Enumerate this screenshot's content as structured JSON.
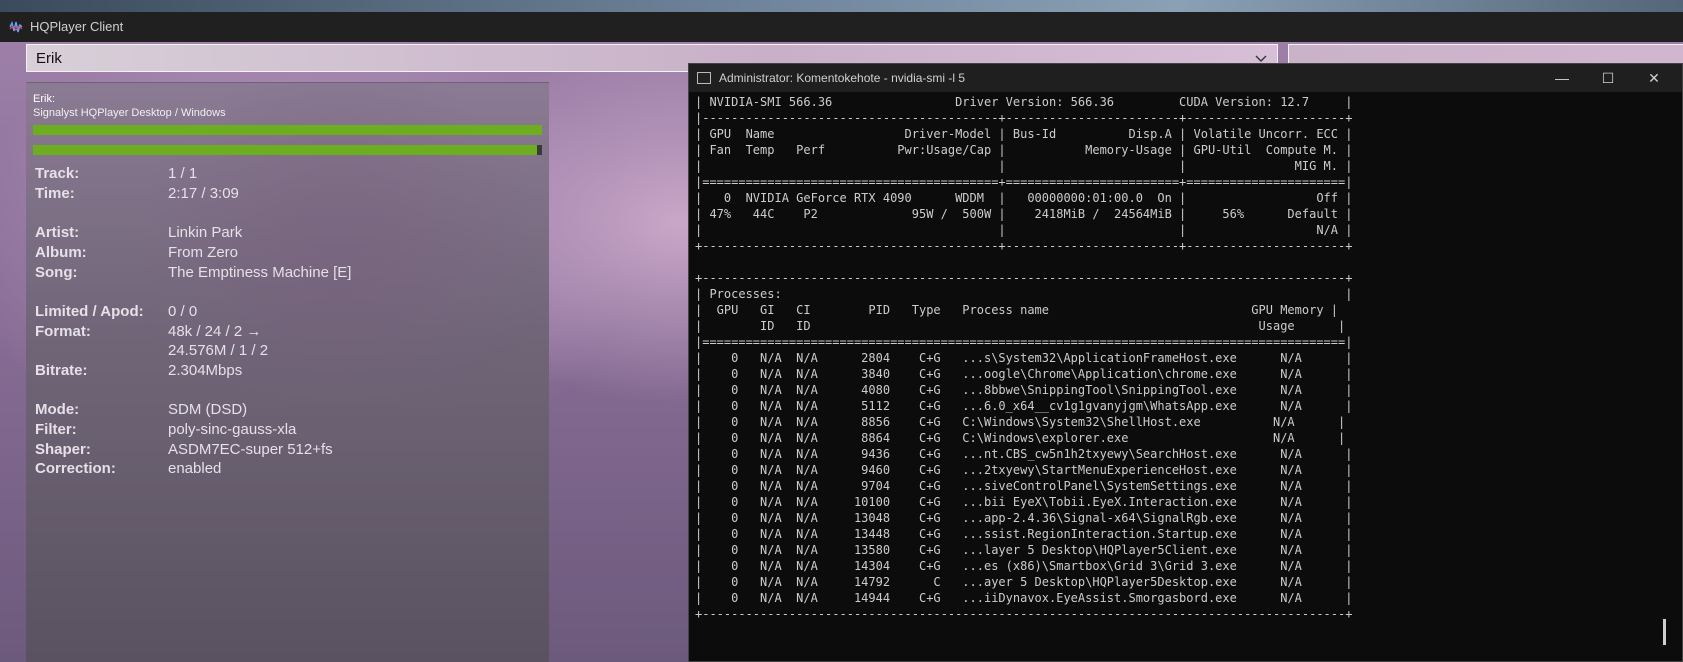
{
  "hqplayer": {
    "title": "HQPlayer Client",
    "dropdown": {
      "selected": "Erik"
    },
    "info": {
      "host": "Erik:",
      "product": "Signalyst HQPlayer Desktop / Windows",
      "progress_top": 1.0,
      "progress_bottom": 0.99,
      "rows": [
        {
          "label": "Track:",
          "value": "1 / 1"
        },
        {
          "label": "Time:",
          "value": "2:17 / 3:09"
        },
        {
          "label": "Artist:",
          "value": "Linkin Park"
        },
        {
          "label": "Album:",
          "value": "From Zero"
        },
        {
          "label": "Song:",
          "value": "The Emptiness Machine [E]"
        },
        {
          "label": "Limited / Apod:",
          "value": "0 / 0"
        },
        {
          "label": "Format:",
          "value": "48k / 24 / 2 →"
        },
        {
          "label": "",
          "value": "24.576M / 1 / 2"
        },
        {
          "label": "Bitrate:",
          "value": "2.304Mbps"
        },
        {
          "label": "Mode:",
          "value": "SDM (DSD)"
        },
        {
          "label": "Filter:",
          "value": "poly-sinc-gauss-xla"
        },
        {
          "label": "Shaper:",
          "value": "ASDM7EC-super 512+fs"
        },
        {
          "label": "Correction:",
          "value": "enabled"
        }
      ]
    }
  },
  "console": {
    "title": "Administrator: Komentokehote - nvidia-smi  -l 5",
    "controls": {
      "minimize": "—",
      "maximize": "☐",
      "close": "✕"
    },
    "lines": [
      "| NVIDIA-SMI 566.36                 Driver Version: 566.36         CUDA Version: 12.7     |",
      "|-----------------------------------------+------------------------+----------------------+",
      "| GPU  Name                  Driver-Model | Bus-Id          Disp.A | Volatile Uncorr. ECC |",
      "| Fan  Temp   Perf          Pwr:Usage/Cap |           Memory-Usage | GPU-Util  Compute M. |",
      "|                                         |                        |               MIG M. |",
      "|=========================================+========================+======================|",
      "|   0  NVIDIA GeForce RTX 4090      WDDM  |   00000000:01:00.0  On |                  Off |",
      "| 47%   44C    P2             95W /  500W |    2418MiB /  24564MiB |     56%      Default |",
      "|                                         |                        |                  N/A |",
      "+-----------------------------------------+------------------------+----------------------+",
      "",
      "+-----------------------------------------------------------------------------------------+",
      "| Processes:                                                                              |",
      "|  GPU   GI   CI        PID   Type   Process name                            GPU Memory |",
      "|        ID   ID                                                              Usage      |",
      "|=========================================================================================|",
      "|    0   N/A  N/A      2804    C+G   ...s\\System32\\ApplicationFrameHost.exe      N/A      |",
      "|    0   N/A  N/A      3840    C+G   ...oogle\\Chrome\\Application\\chrome.exe      N/A      |",
      "|    0   N/A  N/A      4080    C+G   ...8bbwe\\SnippingTool\\SnippingTool.exe      N/A      |",
      "|    0   N/A  N/A      5112    C+G   ...6.0_x64__cv1g1gvanyjgm\\WhatsApp.exe      N/A      |",
      "|    0   N/A  N/A      8856    C+G   C:\\Windows\\System32\\ShellHost.exe          N/A      |",
      "|    0   N/A  N/A      8864    C+G   C:\\Windows\\explorer.exe                    N/A      |",
      "|    0   N/A  N/A      9436    C+G   ...nt.CBS_cw5n1h2txyewy\\SearchHost.exe      N/A      |",
      "|    0   N/A  N/A      9460    C+G   ...2txyewy\\StartMenuExperienceHost.exe      N/A      |",
      "|    0   N/A  N/A      9704    C+G   ...siveControlPanel\\SystemSettings.exe      N/A      |",
      "|    0   N/A  N/A     10100    C+G   ...bii EyeX\\Tobii.EyeX.Interaction.exe      N/A      |",
      "|    0   N/A  N/A     13048    C+G   ...app-2.4.36\\Signal-x64\\SignalRgb.exe      N/A      |",
      "|    0   N/A  N/A     13448    C+G   ...ssist.RegionInteraction.Startup.exe      N/A      |",
      "|    0   N/A  N/A     13580    C+G   ...layer 5 Desktop\\HQPlayer5Client.exe      N/A      |",
      "|    0   N/A  N/A     14304    C+G   ...es (x86)\\Smartbox\\Grid 3\\Grid 3.exe      N/A      |",
      "|    0   N/A  N/A     14792      C   ...ayer 5 Desktop\\HQPlayer5Desktop.exe      N/A      |",
      "|    0   N/A  N/A     14944    C+G   ...iiDynavox.EyeAssist.Smorgasbord.exe      N/A      |",
      "+-----------------------------------------------------------------------------------------+"
    ]
  },
  "colors": {
    "progress": "#6cae1f",
    "console_bg": "#0c0c0c",
    "console_text": "#cccccc"
  }
}
